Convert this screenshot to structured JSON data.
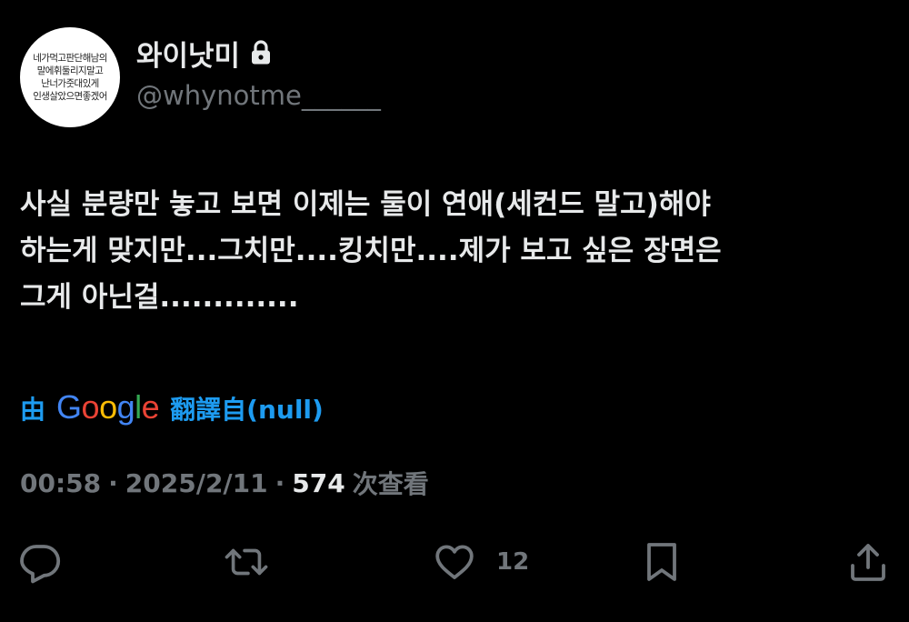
{
  "user": {
    "avatar_lines": [
      "네가먹고판단해남의",
      "말에휘둘리지말고",
      "난너가줏대있게",
      "인생살았으면좋겠어"
    ],
    "display_name": "와이낫미",
    "handle": "@whynotme______",
    "protected_icon": "lock-icon"
  },
  "tweet": {
    "lines": [
      "사실 분량만 놓고 보면 이제는 둘이 연애(세컨드 말고)해야",
      "하는게 맞지만...그치만....킹치만....제가 보고 싶은 장면은",
      "그게 아닌걸............."
    ]
  },
  "translation": {
    "by": "由",
    "google_letters": [
      "G",
      "o",
      "o",
      "g",
      "l",
      "e"
    ],
    "label": "翻譯自(null)",
    "colors": {
      "blue": "#4285f4",
      "red": "#ea4335",
      "yellow": "#fbbc05",
      "green": "#34a853",
      "link": "#1d9bf0"
    }
  },
  "meta": {
    "time": "00:58",
    "separator": "·",
    "date": "2025/2/11",
    "views": "574",
    "views_label": "次查看"
  },
  "actions": {
    "reply": {
      "icon": "reply-icon",
      "count": ""
    },
    "retweet": {
      "icon": "retweet-icon",
      "count": ""
    },
    "like": {
      "icon": "heart-icon",
      "count": "12"
    },
    "bookmark": {
      "icon": "bookmark-icon",
      "count": ""
    },
    "share": {
      "icon": "share-icon",
      "count": ""
    }
  },
  "colors": {
    "background": "#000000",
    "primary_text": "#e7e9ea",
    "secondary_text": "#71767b"
  }
}
